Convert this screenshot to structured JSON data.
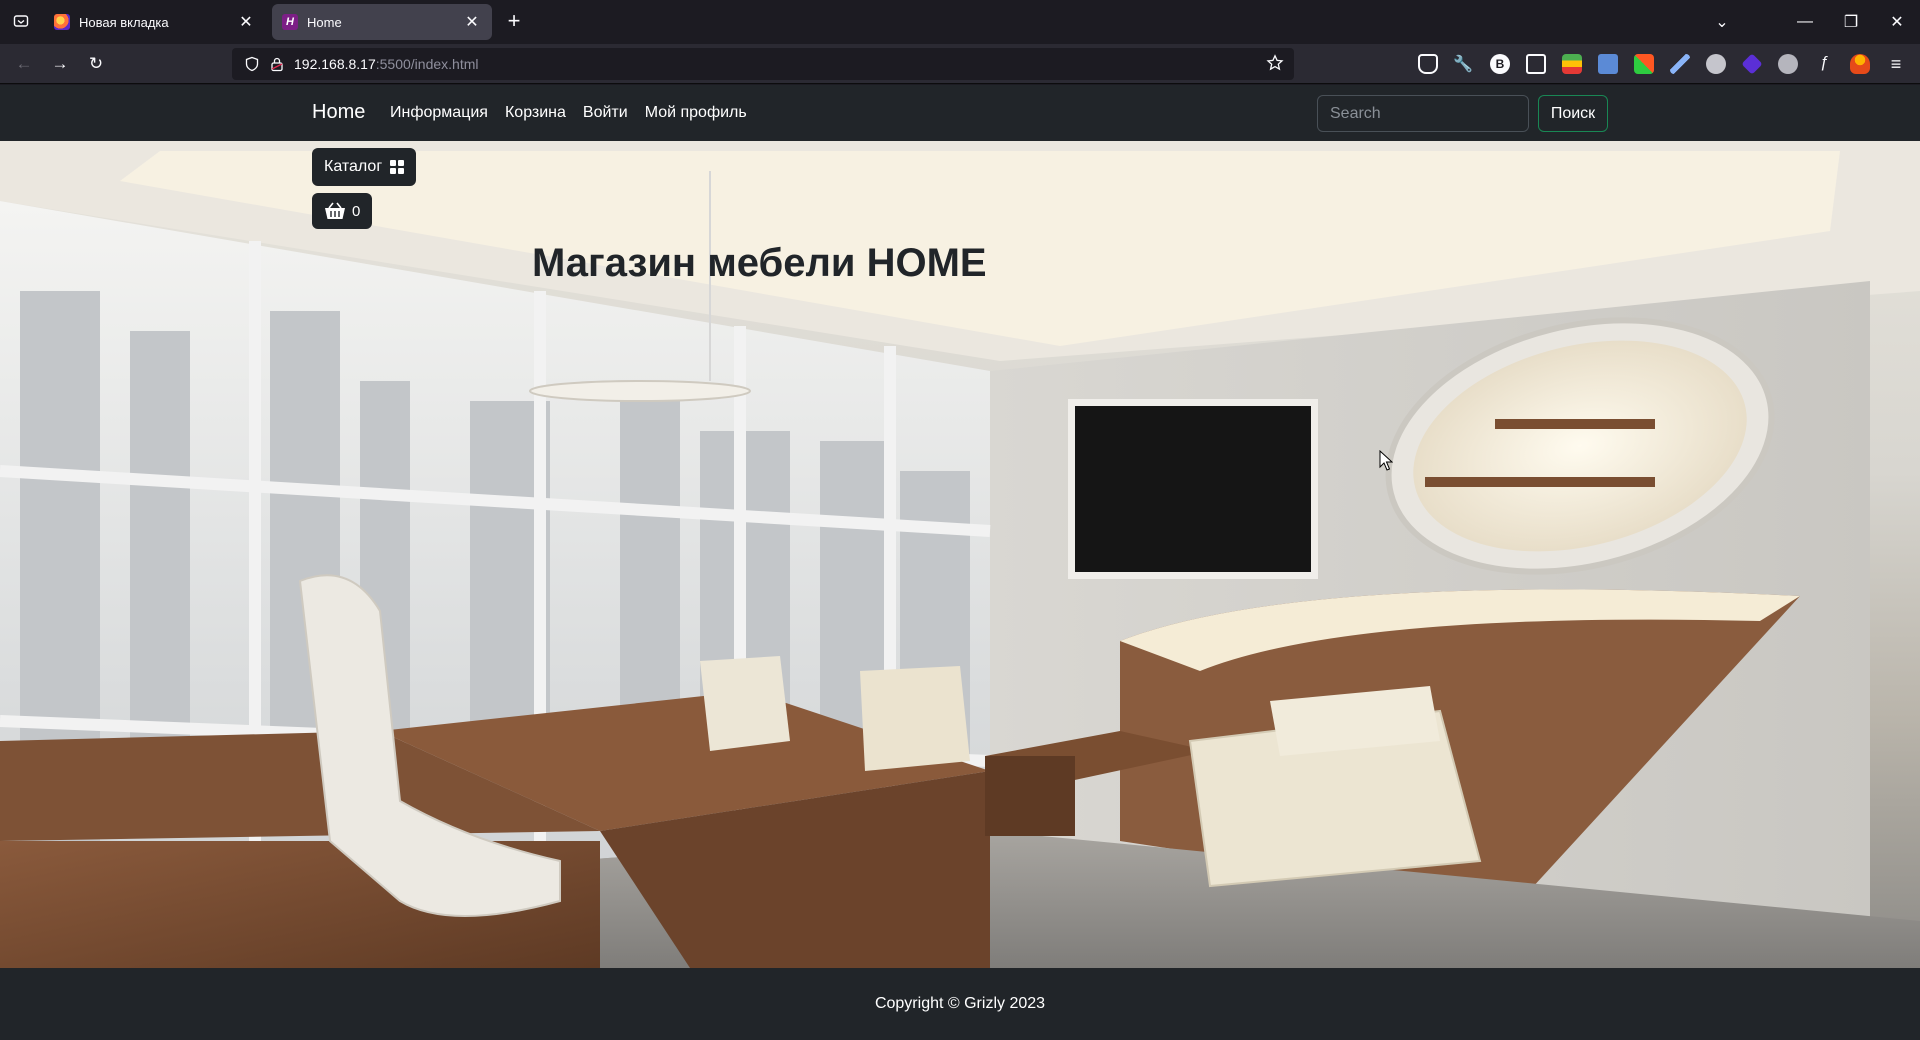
{
  "browser": {
    "tabs": [
      {
        "title": "Новая вкладка",
        "active": false
      },
      {
        "title": "Home",
        "active": true
      }
    ],
    "url_host": "192.168.8.17",
    "url_path": ":5500/index.html"
  },
  "site": {
    "brand": "Home",
    "nav": [
      "Информация",
      "Корзина",
      "Войти",
      "Мой профиль"
    ],
    "search": {
      "placeholder": "Search",
      "button": "Поиск"
    },
    "catalog_label": "Каталог",
    "cart_count": "0",
    "hero_title": "Магазин мебели HOME",
    "footer": "Copyright © Grizly 2023"
  },
  "colors": {
    "navbar_bg": "#212529",
    "search_btn_border": "#198754",
    "browser_bg": "#1c1b22"
  }
}
